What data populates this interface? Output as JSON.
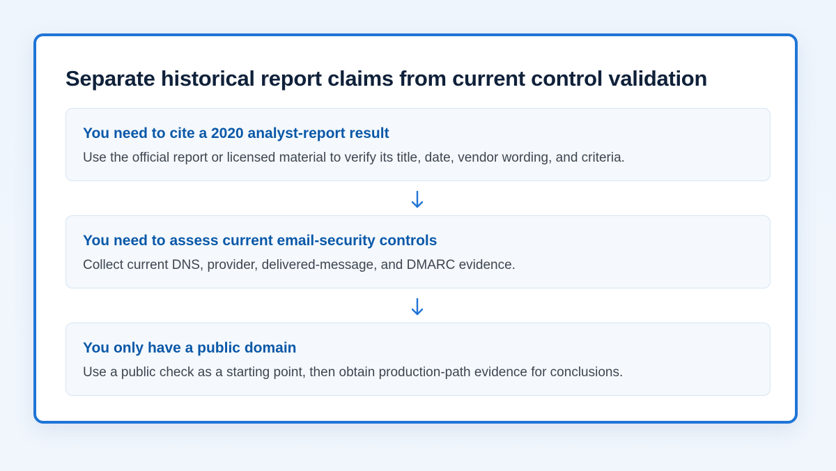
{
  "title": "Separate historical report claims from current control validation",
  "colors": {
    "accent": "#1f74d6",
    "step_title": "#0a58a8",
    "heading": "#10213a",
    "body_text": "#3e4550",
    "step_background": "#f5f9fd",
    "step_border": "#d5e4f3"
  },
  "steps": [
    {
      "title": "You need to cite a 2020 analyst-report result",
      "description": "Use the official report or licensed material to verify its title, date, vendor wording, and criteria."
    },
    {
      "title": "You need to assess current email-security controls",
      "description": "Collect current DNS, provider, delivered-message, and DMARC evidence."
    },
    {
      "title": "You only have a public domain",
      "description": "Use a public check as a starting point, then obtain production-path evidence for conclusions."
    }
  ],
  "connectors": [
    {
      "icon": "arrow-down-icon"
    },
    {
      "icon": "arrow-down-icon"
    }
  ]
}
